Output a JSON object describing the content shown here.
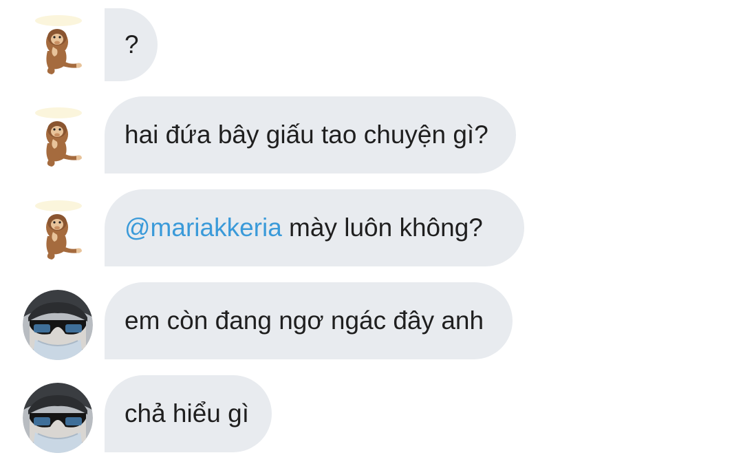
{
  "messages": [
    {
      "sender": "monkey",
      "text": "?"
    },
    {
      "sender": "monkey",
      "text": "hai đứa bây giấu tao chuyện gì?"
    },
    {
      "sender": "monkey",
      "mention": "@mariakkeria",
      "text": " mày luôn không?"
    },
    {
      "sender": "user",
      "text": "em còn đang ngơ ngác đây anh"
    },
    {
      "sender": "user",
      "text": "chả hiểu gì"
    }
  ],
  "colors": {
    "bubble_bg": "#e8ebef",
    "text": "#1f1f1f",
    "mention": "#3a9ad9"
  },
  "icons": {
    "monkey_avatar": "sitting-monkey-sticker-avatar",
    "user_avatar": "person-sunglasses-mask-photo-avatar"
  }
}
